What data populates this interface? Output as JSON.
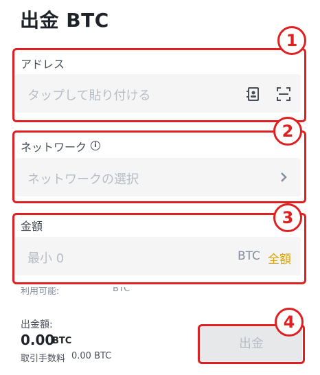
{
  "header": {
    "title": "出金 BTC"
  },
  "address": {
    "label": "アドレス",
    "placeholder": "タップして貼り付ける",
    "icons": [
      "address-book-icon",
      "scan-icon"
    ]
  },
  "network": {
    "label": "ネットワーク",
    "placeholder": "ネットワークの選択",
    "icons": [
      "info-icon",
      "chevron-right-icon"
    ]
  },
  "amount": {
    "label": "金額",
    "placeholder": "最小 0",
    "unit": "BTC",
    "all_label": "全額"
  },
  "available": {
    "label": "利用可能:",
    "unit": "BTC"
  },
  "footer": {
    "withdraw_amount_label": "出金額:",
    "withdraw_amount_value": "0.00",
    "withdraw_amount_unit": "BTC",
    "fee_label": "取引手数料",
    "fee_value": "0.00 BTC",
    "withdraw_button": "出金"
  },
  "markers": [
    "1",
    "2",
    "3",
    "4"
  ],
  "colors": {
    "annotation_red": "#e02020",
    "accent_gold": "#d9a400",
    "field_bg": "#f5f5f5"
  }
}
